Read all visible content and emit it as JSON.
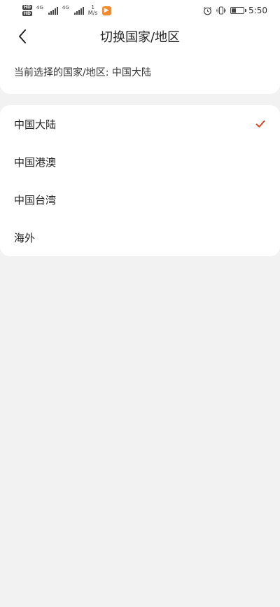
{
  "status_bar": {
    "network_label_1": "4G",
    "network_label_2": "4G",
    "hd_label": "HD",
    "speed_value": "1",
    "speed_unit": "M/s",
    "time": "5:50"
  },
  "header": {
    "title": "切换国家/地区"
  },
  "current_selection": {
    "text": "当前选择的国家/地区: 中国大陆"
  },
  "regions": [
    {
      "label": "中国大陆",
      "selected": true
    },
    {
      "label": "中国港澳",
      "selected": false
    },
    {
      "label": "中国台湾",
      "selected": false
    },
    {
      "label": "海外",
      "selected": false
    }
  ],
  "colors": {
    "accent_check": "#d9431e",
    "background": "#f2f2f2",
    "card": "#ffffff",
    "app_badge": "#f08a2a"
  },
  "icons": {
    "back": "chevron-left-icon",
    "selected": "check-icon",
    "alarm": "alarm-icon",
    "vibrate": "vibrate-icon",
    "battery": "battery-icon"
  }
}
